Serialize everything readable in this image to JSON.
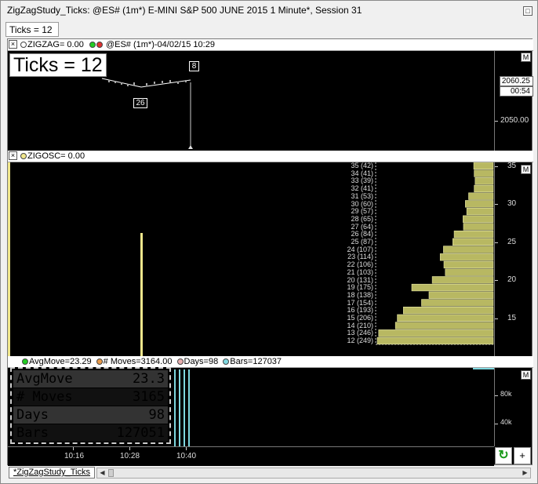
{
  "window": {
    "title": "ZigZagStudy_Ticks: @ES# (1m*) E-MINI S&P 500 JUNE 2015 1 Minute*, Session 31"
  },
  "ticks_tab": {
    "label": "Ticks = 12"
  },
  "pane1": {
    "header": "ZIGZAG= 0.00",
    "header_tail": "@ES# (1m*)-04/02/15 10:29",
    "big_label": "Ticks = 12",
    "box_8": "8",
    "box_26": "26",
    "price_current": "2060.25",
    "price_timer": "00:54",
    "y_tick": "2050.00",
    "m_label": "M"
  },
  "pane2": {
    "header": "ZIGOSC= 0.00",
    "m_label": "M",
    "y_ticks": [
      "35",
      "30",
      "25",
      "20",
      "15"
    ],
    "profile_labels": [
      "35 (42)",
      "34 (41)",
      "33 (39)",
      "32 (41)",
      "31 (53)",
      "30 (60)",
      "29 (57)",
      "28 (65)",
      "27 (64)",
      "26 (84)",
      "25 (87)",
      "24 (107)",
      "23 (114)",
      "22 (106)",
      "21 (103)",
      "20 (131)",
      "19 (175)",
      "18 (138)",
      "17 (154)",
      "16 (193)",
      "15 (206)",
      "14 (210)",
      "13 (246)",
      "12 (249)"
    ],
    "profile_counts": [
      42,
      41,
      39,
      41,
      53,
      60,
      57,
      65,
      64,
      84,
      87,
      107,
      114,
      106,
      103,
      131,
      175,
      138,
      154,
      193,
      206,
      210,
      246,
      249
    ]
  },
  "pane3": {
    "header_avg": "AvgMove=23.29",
    "header_moves": "# Moves=3164.00",
    "header_days": "Days=98",
    "header_bars": "Bars=127037",
    "m_label": "M",
    "y_ticks": [
      "80k",
      "40k"
    ],
    "stats": [
      {
        "label": "AvgMove",
        "value": "23.3",
        "color": "#22cc22"
      },
      {
        "label": "# Moves",
        "value": "3165",
        "color": "#e89a4a"
      },
      {
        "label": "Days",
        "value": "98",
        "color": "#e8b0b0"
      },
      {
        "label": "Bars",
        "value": "127051",
        "color": "#7fd8e0"
      }
    ]
  },
  "time_axis": [
    "10:16",
    "10:28",
    "10:40"
  ],
  "bottom": {
    "tab_label": "*ZigZagStudy_Ticks",
    "refresh_icon": "↻",
    "plus_label": "+"
  },
  "colors": {
    "bar_olive": "#b8b862",
    "bar_yellow": "#f0e68c",
    "accent_green": "#22cc22",
    "cyan": "#7fd8e0"
  }
}
